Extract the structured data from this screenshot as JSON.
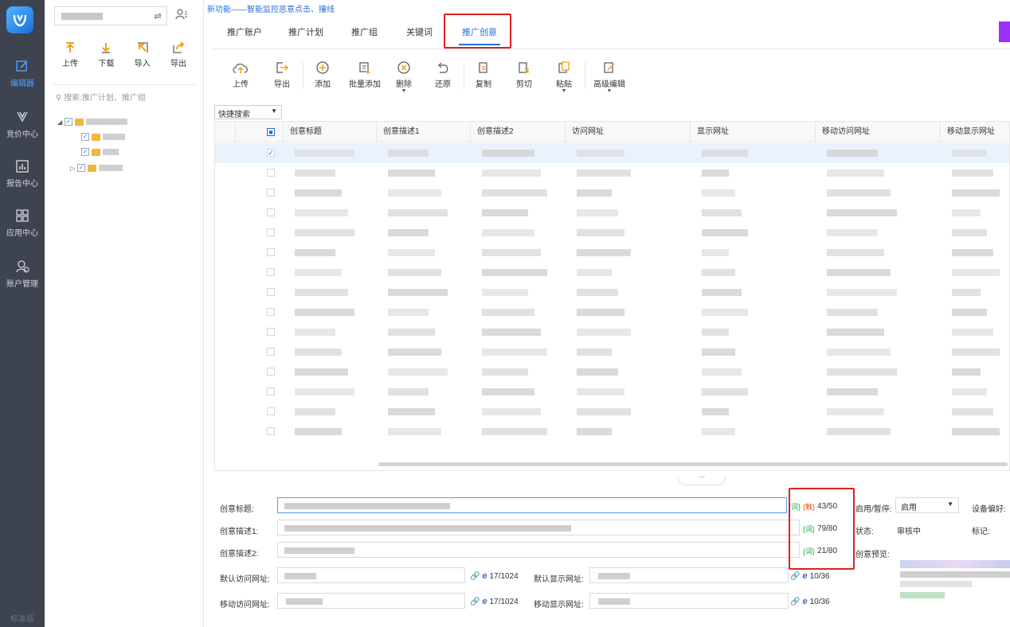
{
  "rail": {
    "items": [
      {
        "label": "编辑器",
        "icon": "edit-icon"
      },
      {
        "label": "竞价中心",
        "icon": "bid-icon"
      },
      {
        "label": "报告中心",
        "icon": "report-icon"
      },
      {
        "label": "应用中心",
        "icon": "apps-icon"
      },
      {
        "label": "账户管理",
        "icon": "account-icon"
      }
    ],
    "bottom_label": "标准版"
  },
  "tree": {
    "swap_glyph": "⇌",
    "tools": [
      {
        "label": "上传",
        "icon": "upload-icon"
      },
      {
        "label": "下载",
        "icon": "download-icon"
      },
      {
        "label": "导入",
        "icon": "import-icon"
      },
      {
        "label": "导出",
        "icon": "export-icon"
      }
    ],
    "search_placeholder": "搜索:推广计划、推广组"
  },
  "banner": "新功能——智能监控恶意点击、撞线",
  "tabs": [
    {
      "label": "推广账户",
      "active": false
    },
    {
      "label": "推广计划",
      "active": false
    },
    {
      "label": "推广组",
      "active": false
    },
    {
      "label": "关键词",
      "active": false
    },
    {
      "label": "推广创意",
      "active": true
    }
  ],
  "toolbar": [
    {
      "label": "上传",
      "icon": "cloud-upload-icon"
    },
    {
      "label": "导出",
      "icon": "export-icon"
    },
    {
      "label": "添加",
      "icon": "add-icon"
    },
    {
      "label": "批量添加",
      "icon": "batch-add-icon"
    },
    {
      "label": "删除",
      "icon": "delete-icon",
      "dropdown": true
    },
    {
      "label": "还原",
      "icon": "undo-icon"
    },
    {
      "label": "复制",
      "icon": "copy-icon"
    },
    {
      "label": "剪切",
      "icon": "cut-icon"
    },
    {
      "label": "粘贴",
      "icon": "paste-icon",
      "dropdown": true
    },
    {
      "label": "高级编辑",
      "icon": "advanced-edit-icon",
      "dropdown": true
    }
  ],
  "quick_search": "快捷搜索",
  "grid": {
    "columns": [
      "创意标题",
      "创意描述1",
      "创意描述2",
      "访问网址",
      "显示网址",
      "移动访问网址",
      "移动显示网址"
    ],
    "row_count": 15,
    "selected_row": 0
  },
  "detail": {
    "title_label": "创意标题:",
    "desc1_label": "创意描述1:",
    "desc2_label": "创意描述2:",
    "url_label": "默认访问网址:",
    "display_url_label": "默认显示网址:",
    "mobile_url_label": "移动访问网址:",
    "mobile_display_label": "移动显示网址:",
    "tag_word": "{词}",
    "tag_break": "{触}",
    "title_count": "43/50",
    "desc1_count": "79/80",
    "desc2_count": "21/80",
    "url_count": "17/1024",
    "display_url_count": "10/36",
    "mobile_url_count": "17/1024",
    "mobile_display_count": "10/36",
    "enable_label": "启用/暂停:",
    "enable_value": "启用",
    "device_label": "设备偏好:",
    "status_label": "状态:",
    "status_value": "审核中",
    "mark_label": "标记:",
    "preview_label": "创意预览:"
  }
}
